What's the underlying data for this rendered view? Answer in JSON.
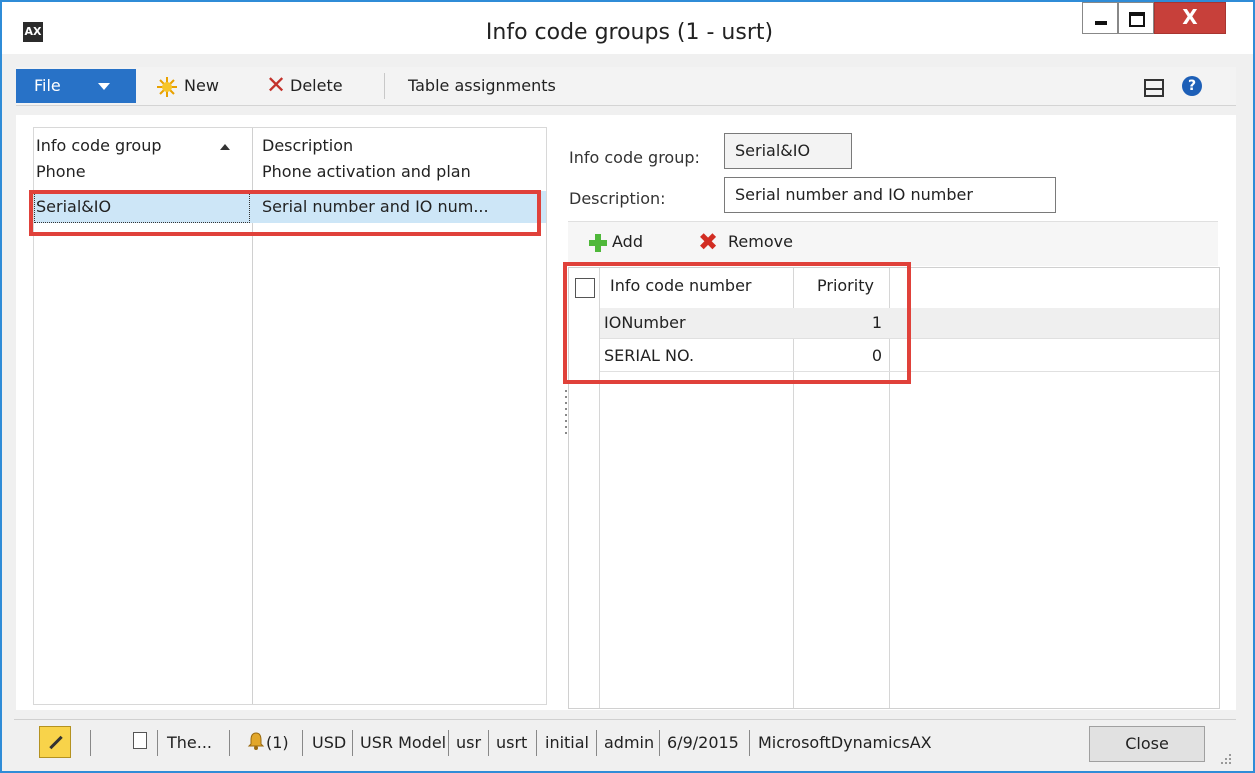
{
  "window": {
    "title": "Info code groups (1 - usrt)",
    "close_glyph": "X"
  },
  "app_icon": "AX",
  "ribbon": {
    "file_label": "File",
    "new_label": "New",
    "delete_label": "Delete",
    "table_assignments_label": "Table assignments",
    "help_glyph": "?"
  },
  "list": {
    "columns": [
      "Info code group",
      "Description"
    ],
    "rows": [
      {
        "group": "Phone",
        "description": "Phone activation and plan"
      },
      {
        "group": "Serial&IO",
        "description": "Serial number and IO num..."
      }
    ]
  },
  "detail": {
    "group_label": "Info code group:",
    "group_value": "Serial&IO",
    "description_label": "Description:",
    "description_value": "Serial number and IO number"
  },
  "grid_toolbar": {
    "add_label": "Add",
    "remove_label": "Remove"
  },
  "grid": {
    "columns": [
      "Info code number",
      "Priority"
    ],
    "rows": [
      {
        "info_code": "IONumber",
        "priority": "1"
      },
      {
        "info_code": "SERIAL NO.",
        "priority": "0"
      }
    ]
  },
  "status_bar": {
    "item_1": "The...",
    "notifications": "(1)",
    "currency": "USD",
    "model": "USR Model",
    "partition": "usr",
    "company": "usrt",
    "layer": "initial",
    "user": "admin",
    "date": "6/9/2015",
    "product": "MicrosoftDynamicsAX",
    "close_label": "Close"
  },
  "colors": {
    "accent": "#2872c7",
    "highlight": "#e0413a",
    "selection": "#cde6f7"
  }
}
